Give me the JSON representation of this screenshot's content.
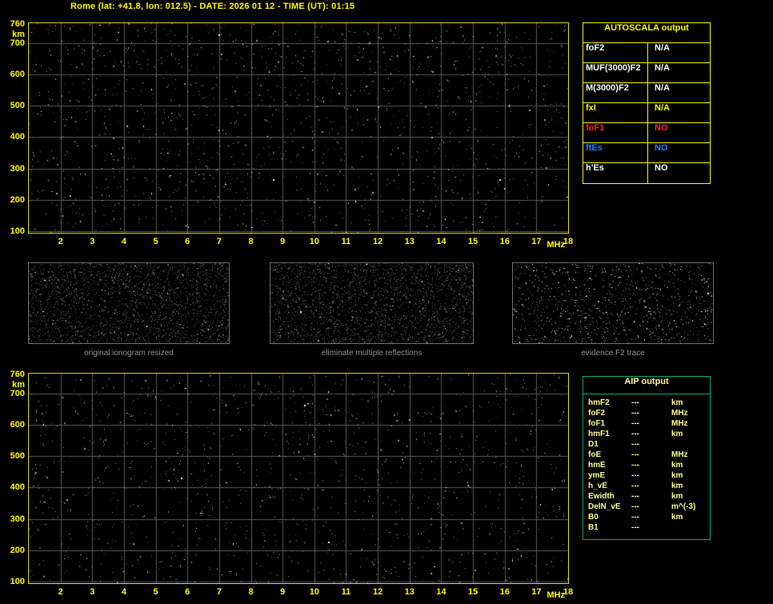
{
  "header": {
    "title": "Rome (lat: +41.8, lon: 012.5) - DATE: 2026 01 12 - TIME (UT): 01:15"
  },
  "autoscala_table": {
    "title": "AUTOSCALA output",
    "rows": [
      {
        "label": "foF2",
        "value": "N/A",
        "color": "#ffffff"
      },
      {
        "label": "MUF(3000)F2",
        "value": "N/A",
        "color": "#ffffff"
      },
      {
        "label": "M(3000)F2",
        "value": "N/A",
        "color": "#ffffff"
      },
      {
        "label": "fxI",
        "value": "N/A",
        "color": "#ffff00"
      },
      {
        "label": "foF1",
        "value": "NO",
        "color": "#ff2020"
      },
      {
        "label": "ftEs",
        "value": "NO",
        "color": "#1f7fff"
      },
      {
        "label": "h'Es",
        "value": "NO",
        "color": "#ffffff"
      }
    ]
  },
  "thumbnails": [
    {
      "caption": "original ionogram resized"
    },
    {
      "caption": "eliminate multiple reflections"
    },
    {
      "caption": "evidence F2 trace"
    }
  ],
  "aip_table": {
    "title": "AIP output",
    "rows": [
      {
        "label": "hmF2",
        "value": "---",
        "unit": "km"
      },
      {
        "label": "foF2",
        "value": "---",
        "unit": "MHz"
      },
      {
        "label": "foF1",
        "value": "---",
        "unit": "MHz"
      },
      {
        "label": "hmF1",
        "value": "---",
        "unit": "km"
      },
      {
        "label": "D1",
        "value": "---",
        "unit": ""
      },
      {
        "label": "foE",
        "value": "---",
        "unit": "MHz"
      },
      {
        "label": "hmE",
        "value": "---",
        "unit": "km"
      },
      {
        "label": "ymE",
        "value": "---",
        "unit": "km"
      },
      {
        "label": "h_vE",
        "value": "---",
        "unit": "km"
      },
      {
        "label": "Ewidth",
        "value": "---",
        "unit": "km"
      },
      {
        "label": "DelN_vE",
        "value": "---",
        "unit": "m^(-3)"
      },
      {
        "label": "B0",
        "value": "---",
        "unit": "km"
      },
      {
        "label": "B1",
        "value": "---",
        "unit": ""
      }
    ]
  },
  "chart_data": [
    {
      "type": "scatter",
      "title": "Received ionogram (top panel)",
      "xlabel": "MHz",
      "ylabel": "km",
      "xlim": [
        1,
        18
      ],
      "ylim": [
        95,
        763
      ],
      "x_ticks": [
        2,
        3,
        4,
        5,
        6,
        7,
        8,
        9,
        10,
        11,
        12,
        13,
        14,
        15,
        16,
        17,
        18
      ],
      "y_ticks": [
        760,
        700,
        600,
        500,
        400,
        300,
        200,
        100
      ],
      "grid": true,
      "series": [],
      "note": "only background noise speckle visible; no echo trace scaled (all AUTOSCALA values N/A or NO)"
    },
    {
      "type": "scatter",
      "title": "Processed ionogram (bottom panel)",
      "xlabel": "MHz",
      "ylabel": "km",
      "xlim": [
        1,
        18
      ],
      "ylim": [
        95,
        763
      ],
      "x_ticks": [
        2,
        3,
        4,
        5,
        6,
        7,
        8,
        9,
        10,
        11,
        12,
        13,
        14,
        15,
        16,
        17,
        18
      ],
      "y_ticks": [
        760,
        700,
        600,
        500,
        400,
        300,
        200,
        100
      ],
      "grid": true,
      "series": [],
      "note": "only background noise speckle visible; no trace identified (AIP values ---)"
    }
  ],
  "colors": {
    "background": "#000000",
    "title_text": "#ffff00",
    "axis_text": "#ffff00",
    "plot_border": "#dede00",
    "grid": "#5a5a5a",
    "autoscala_border": "#ffff00",
    "aip_border": "#00b070",
    "aip_text": "#ffff9c",
    "caption_text": "#8f8f8f",
    "value_white": "#ffffff",
    "fxI_yellow": "#ffff00",
    "foF1_red": "#ff2020",
    "ftEs_blue": "#1f7fff"
  }
}
